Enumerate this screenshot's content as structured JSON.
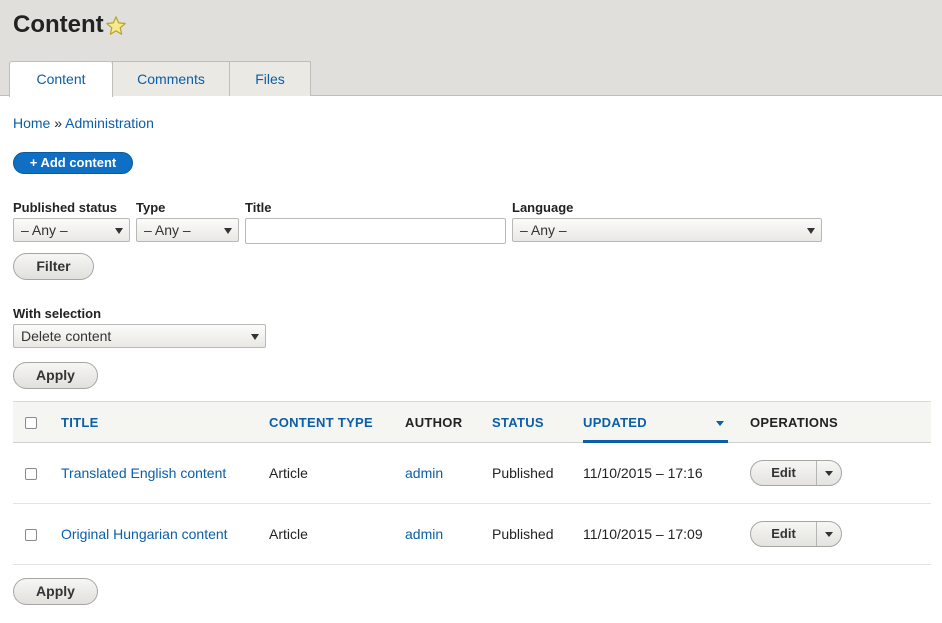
{
  "header": {
    "title": "Content",
    "tabs": [
      {
        "label": "Content",
        "active": true
      },
      {
        "label": "Comments",
        "active": false
      },
      {
        "label": "Files",
        "active": false
      }
    ]
  },
  "breadcrumb": {
    "items": [
      "Home",
      "Administration"
    ],
    "separator": "»"
  },
  "actions": {
    "add_content_label": "+ Add content"
  },
  "filters": {
    "published_status": {
      "label": "Published status",
      "value": "– Any –"
    },
    "type": {
      "label": "Type",
      "value": "– Any –"
    },
    "title": {
      "label": "Title",
      "value": ""
    },
    "language": {
      "label": "Language",
      "value": "– Any –"
    },
    "filter_button": "Filter"
  },
  "bulk": {
    "label": "With selection",
    "value": "Delete content",
    "apply_button": "Apply"
  },
  "table": {
    "columns": [
      "TITLE",
      "CONTENT TYPE",
      "AUTHOR",
      "STATUS",
      "UPDATED",
      "OPERATIONS"
    ],
    "rows": [
      {
        "title": "Translated English content",
        "content_type": "Article",
        "author": "admin",
        "status": "Published",
        "updated": "11/10/2015 – 17:16",
        "operation": "Edit"
      },
      {
        "title": "Original Hungarian content",
        "content_type": "Article",
        "author": "admin",
        "status": "Published",
        "updated": "11/10/2015 – 17:09",
        "operation": "Edit"
      }
    ]
  },
  "bottom": {
    "apply_button": "Apply"
  },
  "colors": {
    "accent": "#0b5ea8",
    "primary_button": "#0f6fc4",
    "header_bg": "#e0dfdb"
  }
}
